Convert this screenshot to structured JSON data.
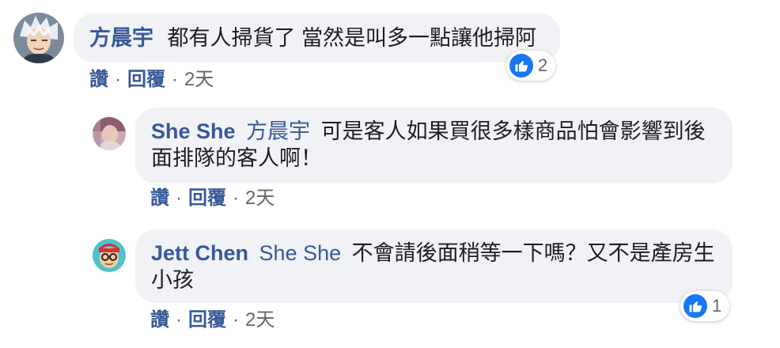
{
  "comments": [
    {
      "author": "方晨宇",
      "mention": "",
      "text": "都有人掃貨了 當然是叫多一點讓他掃阿",
      "reaction_count": "2",
      "actions": {
        "like": "讚",
        "reply": "回覆",
        "time": "2天"
      }
    },
    {
      "author": "She She",
      "mention": "方晨宇",
      "text": "可是客人如果買很多樣商品怕會影響到後面排隊的客人啊！",
      "reaction_count": "",
      "actions": {
        "like": "讚",
        "reply": "回覆",
        "time": "2天"
      }
    },
    {
      "author": "Jett Chen",
      "mention": "She She",
      "text": "不會請後面稍等一下嗎？又不是產房生小孩",
      "reaction_count": "1",
      "actions": {
        "like": "讚",
        "reply": "回覆",
        "time": "2天"
      }
    }
  ],
  "separator": "·",
  "colors": {
    "link": "#385898",
    "bubble": "#f0f2f5",
    "like": "#1877f2",
    "meta": "#606770"
  },
  "icons": [
    "avatar-gintoki",
    "avatar-sheshe",
    "avatar-jett",
    "thumbs-up-icon"
  ]
}
